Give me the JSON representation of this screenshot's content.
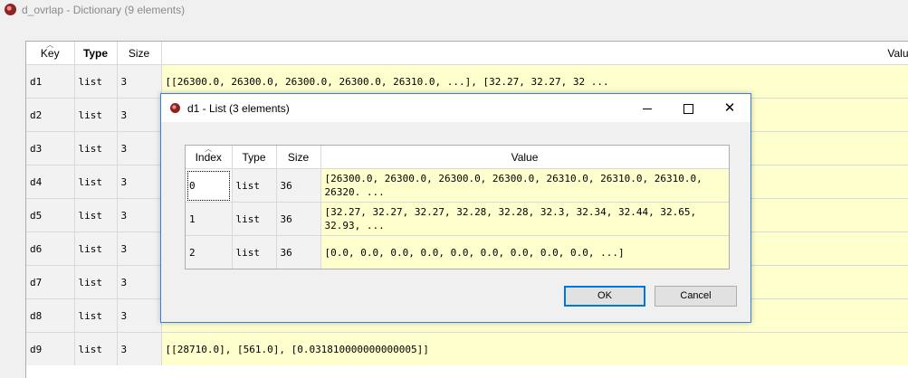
{
  "window": {
    "title": "d_ovrlap - Dictionary (9 elements)"
  },
  "outer_table": {
    "headers": {
      "key": "Key",
      "type": "Type",
      "size": "Size",
      "value": "Valu"
    },
    "rows": [
      {
        "key": "d1",
        "type": "list",
        "size": "3",
        "value": "[[26300.0, 26300.0, 26300.0, 26300.0, 26310.0, ...], [32.27, 32.27, 32 ..."
      },
      {
        "key": "d2",
        "type": "list",
        "size": "3",
        "value": ""
      },
      {
        "key": "d3",
        "type": "list",
        "size": "3",
        "value": ""
      },
      {
        "key": "d4",
        "type": "list",
        "size": "3",
        "value": ""
      },
      {
        "key": "d5",
        "type": "list",
        "size": "3",
        "value": ""
      },
      {
        "key": "d6",
        "type": "list",
        "size": "3",
        "value": ""
      },
      {
        "key": "d7",
        "type": "list",
        "size": "3",
        "value": ""
      },
      {
        "key": "d8",
        "type": "list",
        "size": "3",
        "value": ""
      },
      {
        "key": "d9",
        "type": "list",
        "size": "3",
        "value": "[[28710.0], [561.0], [0.031810000000000005]]"
      }
    ]
  },
  "dialog": {
    "title": "d1 - List (3 elements)",
    "headers": {
      "index": "Index",
      "type": "Type",
      "size": "Size",
      "value": "Value"
    },
    "rows": [
      {
        "index": "0",
        "type": "list",
        "size": "36",
        "value": "[26300.0, 26300.0, 26300.0, 26300.0, 26310.0, 26310.0, 26310.0, 26320. ..."
      },
      {
        "index": "1",
        "type": "list",
        "size": "36",
        "value": "[32.27, 32.27, 32.27, 32.28, 32.28, 32.3, 32.34, 32.44, 32.65, 32.93, ..."
      },
      {
        "index": "2",
        "type": "list",
        "size": "36",
        "value": "[0.0, 0.0, 0.0, 0.0, 0.0, 0.0, 0.0, 0.0, 0.0, ...]"
      }
    ],
    "ok_label": "OK",
    "cancel_label": "Cancel"
  },
  "colors": {
    "value_cell_bg": "#ffffce",
    "label_cell_bg": "#f2f2f2",
    "focus_border": "#0078d7"
  }
}
